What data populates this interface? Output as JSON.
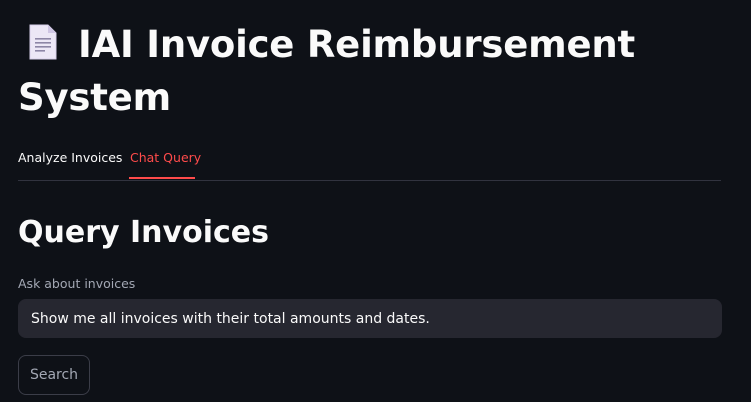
{
  "header": {
    "title": "IAI Invoice Reimbursement System",
    "icon": "page-facing-up-icon"
  },
  "tabs": [
    {
      "label": "Analyze Invoices",
      "active": false
    },
    {
      "label": "Chat Query",
      "active": true
    }
  ],
  "section": {
    "title": "Query Invoices"
  },
  "query": {
    "label": "Ask about invoices",
    "value": "Show me all invoices with their total amounts and dates."
  },
  "search_button": {
    "label": "Search"
  },
  "colors": {
    "background": "#0e1117",
    "accent": "#ff4b4b",
    "input_bg": "#262730",
    "text": "#fafafa",
    "muted_text": "#a3a8b4"
  }
}
